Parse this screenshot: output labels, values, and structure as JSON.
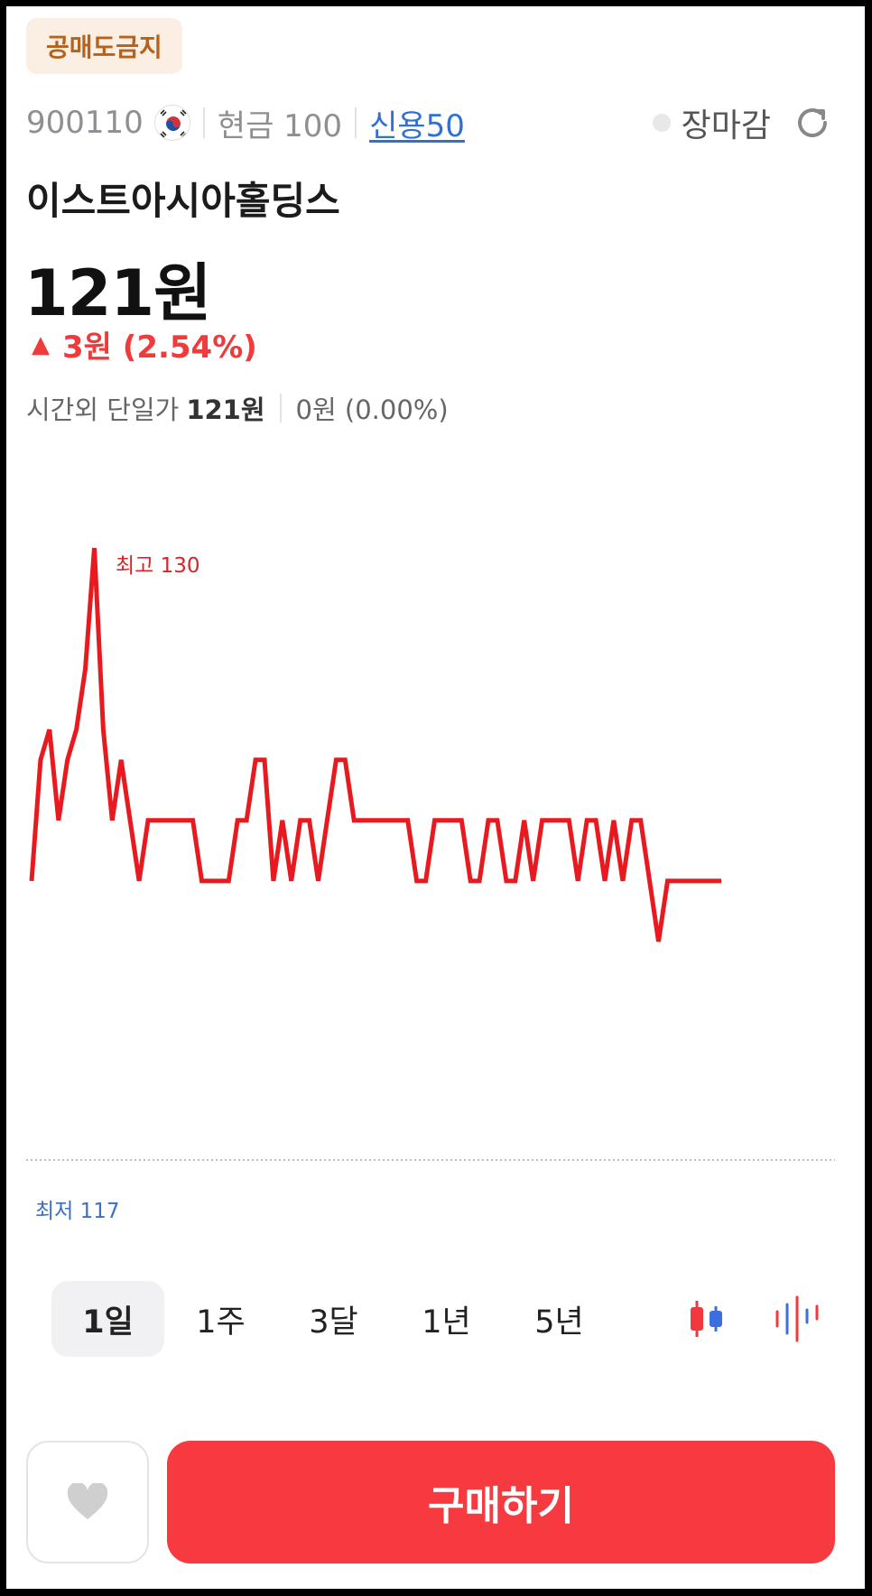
{
  "badge": {
    "label": "공매도금지"
  },
  "stock": {
    "code": "900110",
    "cash_label": "현금 100",
    "credit_label": "신용50",
    "name": "이스트아시아홀딩스",
    "price": "121원",
    "change_arrow": "▲",
    "change_text": "3원 (2.54%)",
    "afterhours_label": "시간외 단일가",
    "afterhours_price": "121원",
    "afterhours_change": "0원 (0.00%)"
  },
  "market": {
    "status_label": "장마감"
  },
  "colors": {
    "up": "#ef3b3b",
    "line": "#e81a1f",
    "low": "#3b6fc6",
    "buy": "#f63a3f",
    "badge_bg": "#fbeee3",
    "badge_text": "#b5621d",
    "link": "#2f6fd6"
  },
  "chart_data": {
    "type": "line",
    "high_label": "최고 130",
    "low_label": "최저 117",
    "ylim": [
      117,
      130
    ],
    "values": [
      119,
      123,
      124,
      121,
      123,
      124,
      126,
      130,
      124,
      121,
      123,
      121,
      119,
      121,
      121,
      121,
      121,
      121,
      121,
      119,
      119,
      119,
      119,
      121,
      121,
      123,
      123,
      119,
      121,
      119,
      121,
      121,
      119,
      121,
      123,
      123,
      121,
      121,
      121,
      121,
      121,
      121,
      121,
      119,
      119,
      121,
      121,
      121,
      121,
      119,
      119,
      121,
      121,
      119,
      119,
      121,
      119,
      121,
      121,
      121,
      121,
      119,
      121,
      121,
      119,
      121,
      119,
      121,
      121,
      119,
      117,
      119,
      119,
      119,
      119,
      119,
      119,
      119
    ]
  },
  "periods": [
    {
      "label": "1일",
      "active": true
    },
    {
      "label": "1주",
      "active": false
    },
    {
      "label": "3달",
      "active": false
    },
    {
      "label": "1년",
      "active": false
    },
    {
      "label": "5년",
      "active": false
    }
  ],
  "icons": {
    "flag": "korea-flag-icon",
    "refresh": "refresh-icon",
    "candle": "candlestick-icon",
    "volume": "volume-bars-icon",
    "favorite": "heart-icon"
  },
  "actions": {
    "buy_label": "구매하기"
  }
}
